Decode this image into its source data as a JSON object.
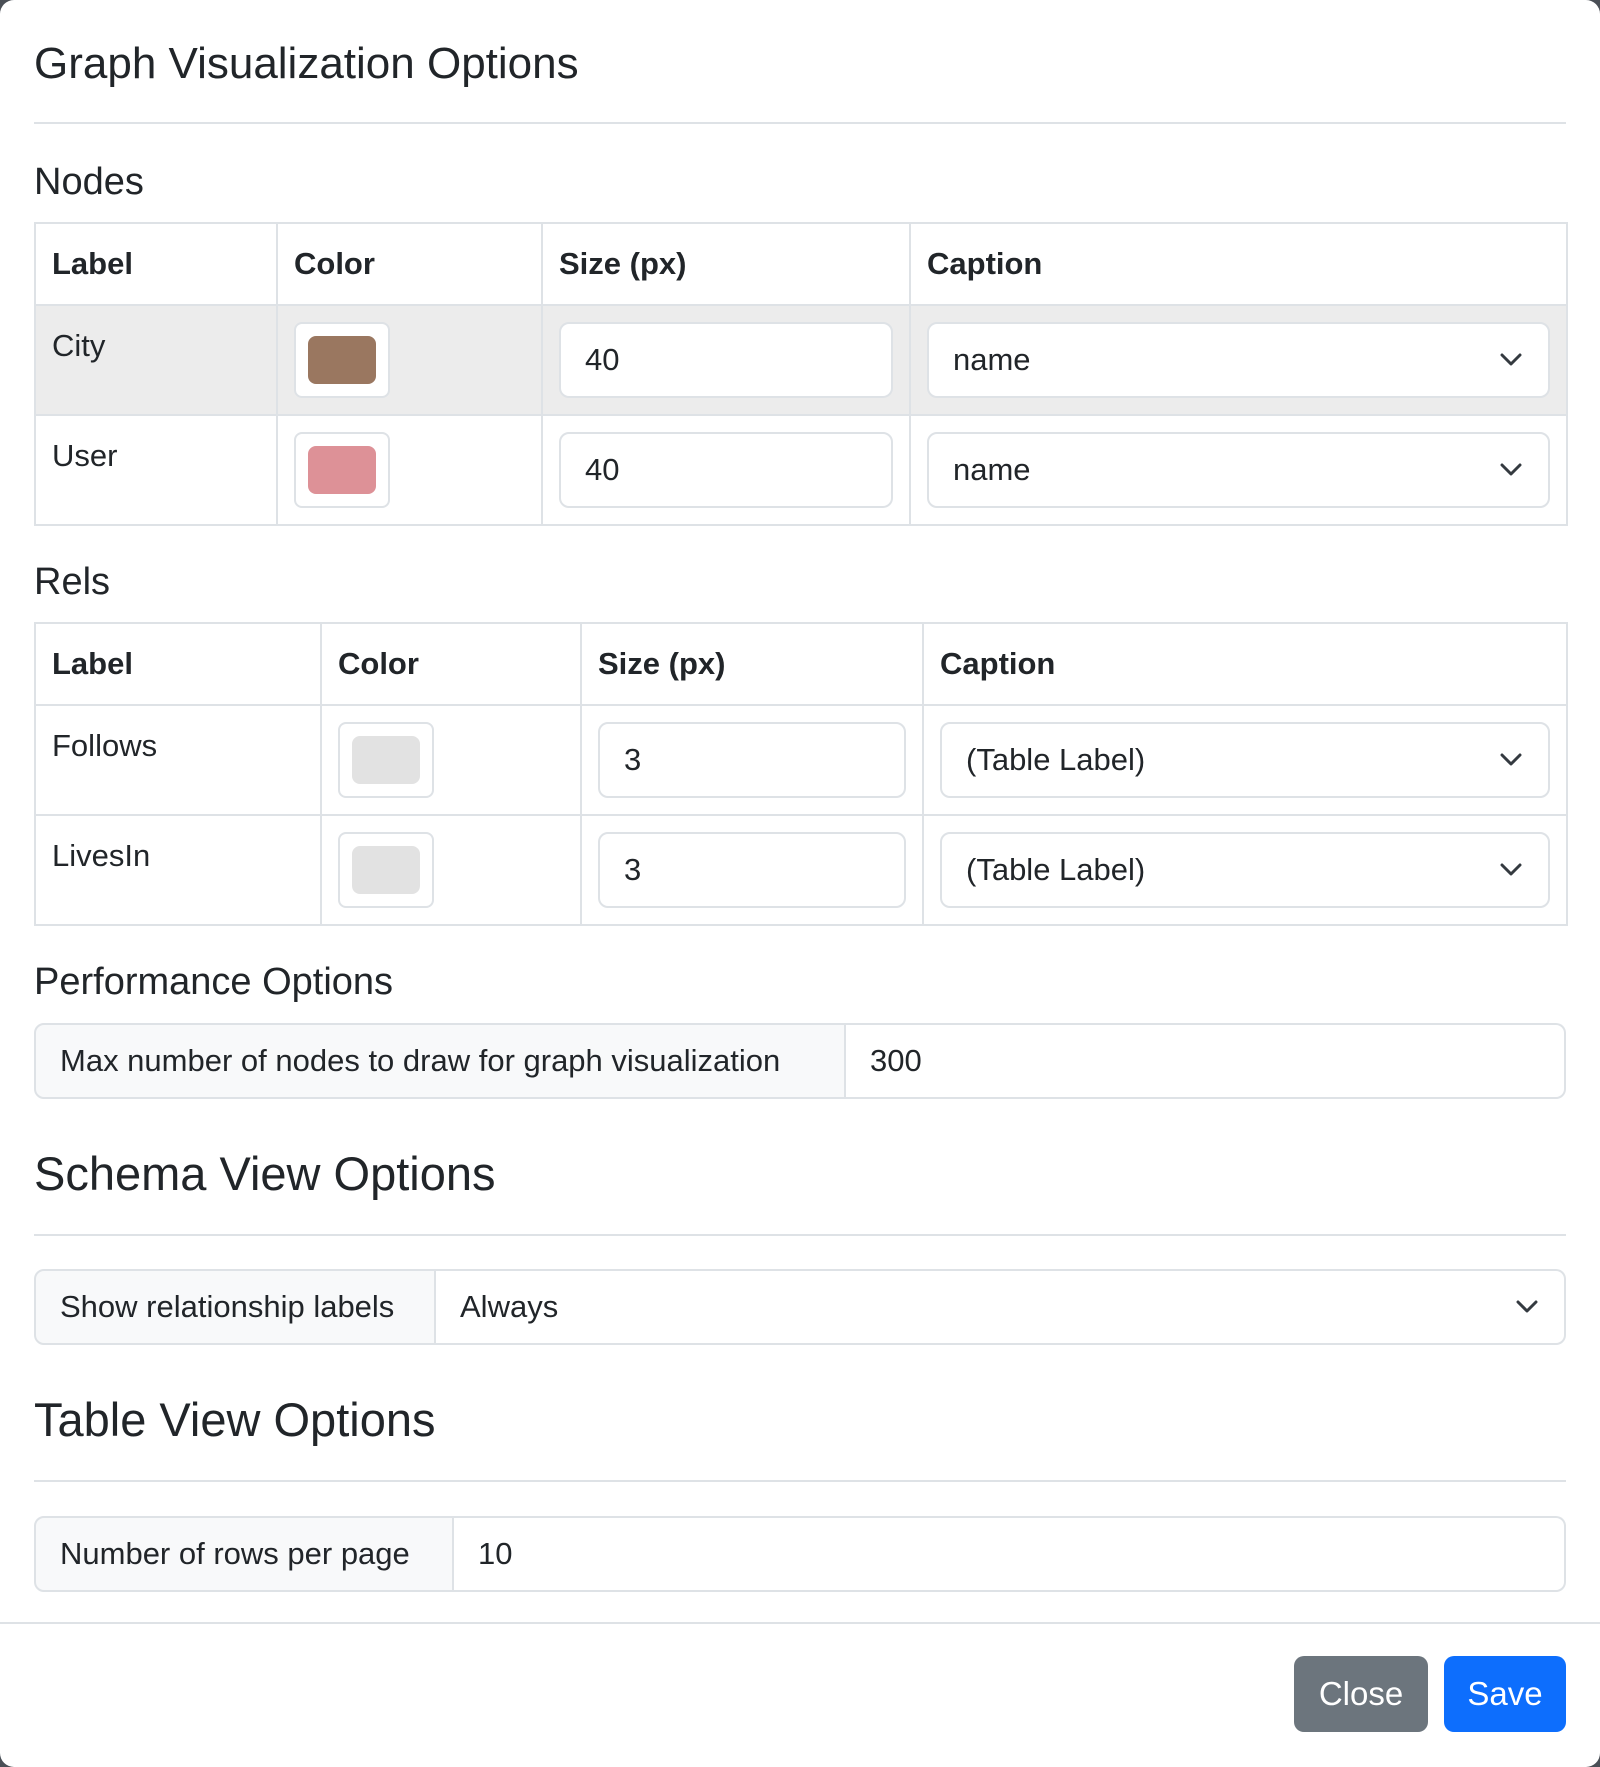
{
  "dialog": {
    "title": "Graph Visualization Options"
  },
  "nodes": {
    "heading": "Nodes",
    "columns": [
      "Label",
      "Color",
      "Size (px)",
      "Caption"
    ],
    "rows": [
      {
        "label": "City",
        "color": "#9a7760",
        "size": "40",
        "caption": "name"
      },
      {
        "label": "User",
        "color": "#dd9197",
        "size": "40",
        "caption": "name"
      }
    ]
  },
  "rels": {
    "heading": "Rels",
    "columns": [
      "Label",
      "Color",
      "Size (px)",
      "Caption"
    ],
    "rows": [
      {
        "label": "Follows",
        "color": "#e2e2e2",
        "size": "3",
        "caption": "(Table Label)"
      },
      {
        "label": "LivesIn",
        "color": "#e2e2e2",
        "size": "3",
        "caption": "(Table Label)"
      }
    ]
  },
  "performance": {
    "heading": "Performance Options",
    "max_nodes_label": "Max number of nodes to draw for graph visualization",
    "max_nodes_value": "300"
  },
  "schema_view": {
    "heading": "Schema View Options",
    "show_rel_labels_label": "Show relationship labels",
    "show_rel_labels_value": "Always"
  },
  "table_view": {
    "heading": "Table View Options",
    "rows_per_page_label": "Number of rows per page",
    "rows_per_page_value": "10"
  },
  "footer": {
    "close_label": "Close",
    "save_label": "Save"
  },
  "colors": {
    "primary": "#0d6efd",
    "secondary": "#6c757d",
    "border": "#dee2e6",
    "highlight_row": "#ececec"
  }
}
